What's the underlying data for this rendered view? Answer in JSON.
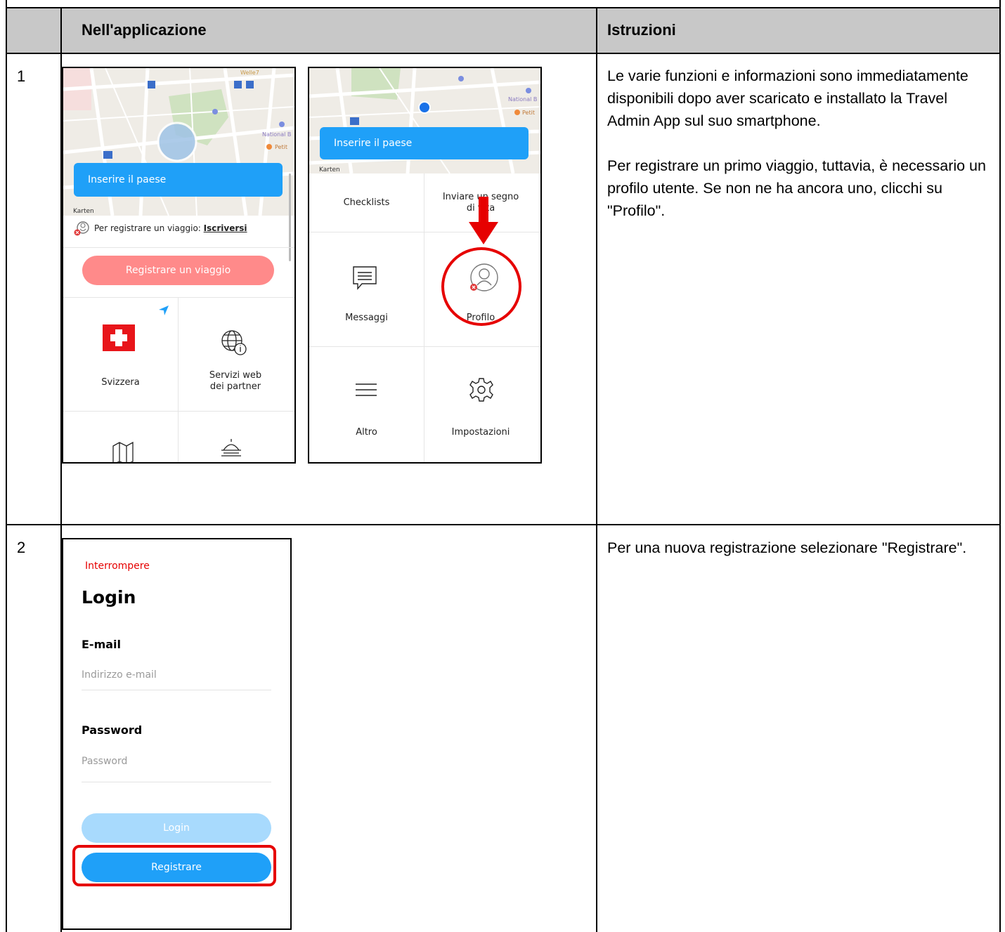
{
  "table": {
    "header": {
      "col_app": "Nell'applicazione",
      "col_instr": "Istruzioni"
    },
    "rows": [
      {
        "num": "1",
        "instructions": [
          "Le varie funzioni e informazioni sono immediatamente disponibili dopo aver scaricato e installato la Travel Admin App sul suo smartphone.",
          "Per registrare un primo viaggio, tuttavia, è necessario un profilo utente. Se non ne ha ancora uno, clicchi su \"Profilo\"."
        ]
      },
      {
        "num": "2",
        "instructions": [
          "Per una nuova registrazione selezionare \"Registrare\"."
        ]
      }
    ]
  },
  "phone1": {
    "map_labels": [
      "Welle7",
      "National B",
      "Petit",
      "Karten"
    ],
    "country_button": "Inserire il paese",
    "register_prompt": "Per registrare un viaggio:",
    "register_link": "Iscriversi",
    "register_trip_button": "Registrare un viaggio",
    "tiles": [
      "Svizzera",
      "Servizi web dei partner"
    ]
  },
  "phone2": {
    "map_labels": [
      "National B",
      "Petit",
      "Karten"
    ],
    "country_button": "Inserire il paese",
    "tiles": [
      "Checklists",
      "Inviare un segno di vita",
      "Messaggi",
      "Profilo",
      "Altro",
      "Impostazioni"
    ]
  },
  "phone3": {
    "cancel": "Interrompere",
    "title": "Login",
    "email_label": "E-mail",
    "email_placeholder": "Indirizzo e-mail",
    "password_label": "Password",
    "password_placeholder": "Password",
    "login_button": "Login",
    "register_button": "Registrare"
  },
  "colors": {
    "accent_blue": "#1fa0f8",
    "highlight_red": "#e60000",
    "header_gray": "#c8c8c8"
  }
}
